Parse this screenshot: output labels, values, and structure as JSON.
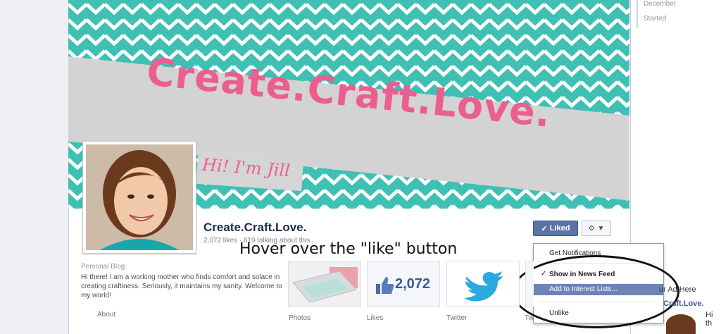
{
  "timeline": {
    "items": [
      "December",
      "Started"
    ]
  },
  "cover": {
    "title": "Create.Craft.Love.",
    "tagline": "Hi! I'm Jill"
  },
  "page": {
    "name": "Create.Craft.Love.",
    "stats": "2,072 likes · 819 talking about this"
  },
  "actions": {
    "liked_label": "Liked",
    "annotation": "Hover over the \"like\" button"
  },
  "dropdown": {
    "items": [
      "Get Notifications",
      "Show in News Feed",
      "Add to Interest Lists...",
      "Unlike"
    ]
  },
  "about": {
    "category": "Personal Blog",
    "text": "Hi there! I am a working mother who finds comfort and solace in creating craftiness. Seriously, it maintains my sanity. Welcome to my world!",
    "link_label": "About"
  },
  "apps": {
    "photos_label": "Photos",
    "likes_label": "Likes",
    "likes_count": "2,072",
    "twitter_label": "Twitter",
    "fourth_label": "Tw"
  },
  "right_column": {
    "line1": "ur Ad Here",
    "line2": "Craft.Love.",
    "line3": "Hi th"
  },
  "colors": {
    "accent": "#3b5998",
    "cover_teal": "#3ec0b4",
    "cover_pink": "#ec5e8f"
  }
}
